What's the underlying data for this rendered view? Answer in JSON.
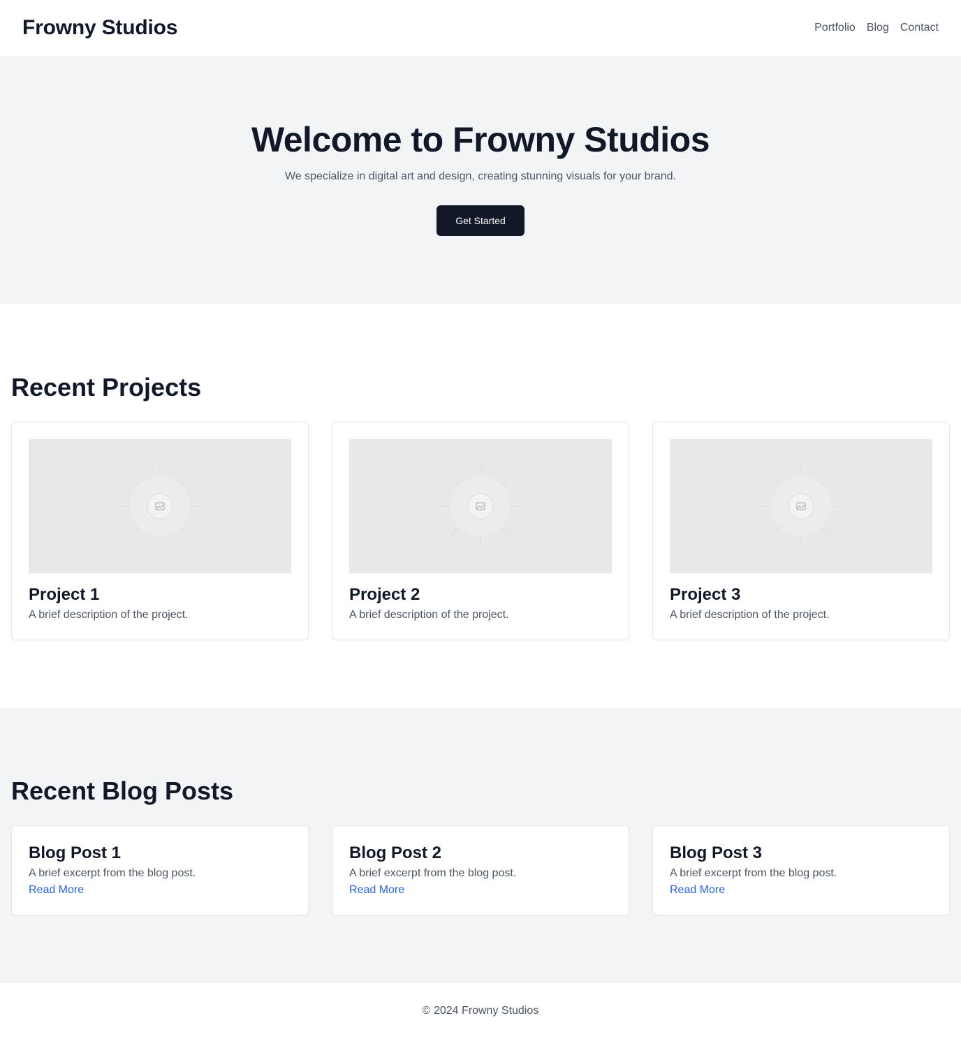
{
  "header": {
    "brand": "Frowny Studios",
    "nav": [
      "Portfolio",
      "Blog",
      "Contact"
    ]
  },
  "hero": {
    "title": "Welcome to Frowny Studios",
    "subtitle": "We specialize in digital art and design, creating stunning visuals for your brand.",
    "cta": "Get Started"
  },
  "projects": {
    "title": "Recent Projects",
    "items": [
      {
        "title": "Project 1",
        "description": "A brief description of the project.",
        "icon": "image-placeholder-icon"
      },
      {
        "title": "Project 2",
        "description": "A brief description of the project.",
        "icon": "image-placeholder-icon"
      },
      {
        "title": "Project 3",
        "description": "A brief description of the project.",
        "icon": "image-placeholder-icon"
      }
    ]
  },
  "blog": {
    "title": "Recent Blog Posts",
    "items": [
      {
        "title": "Blog Post 1",
        "excerpt": "A brief excerpt from the blog post.",
        "link": "Read More"
      },
      {
        "title": "Blog Post 2",
        "excerpt": "A brief excerpt from the blog post.",
        "link": "Read More"
      },
      {
        "title": "Blog Post 3",
        "excerpt": "A brief excerpt from the blog post.",
        "link": "Read More"
      }
    ]
  },
  "footer": {
    "copyright": "© 2024 Frowny Studios"
  },
  "colors": {
    "text_dark": "#111827",
    "text_muted": "#4b5563",
    "link": "#2563eb",
    "section_bg": "#f3f4f6",
    "button_bg": "#111827"
  }
}
